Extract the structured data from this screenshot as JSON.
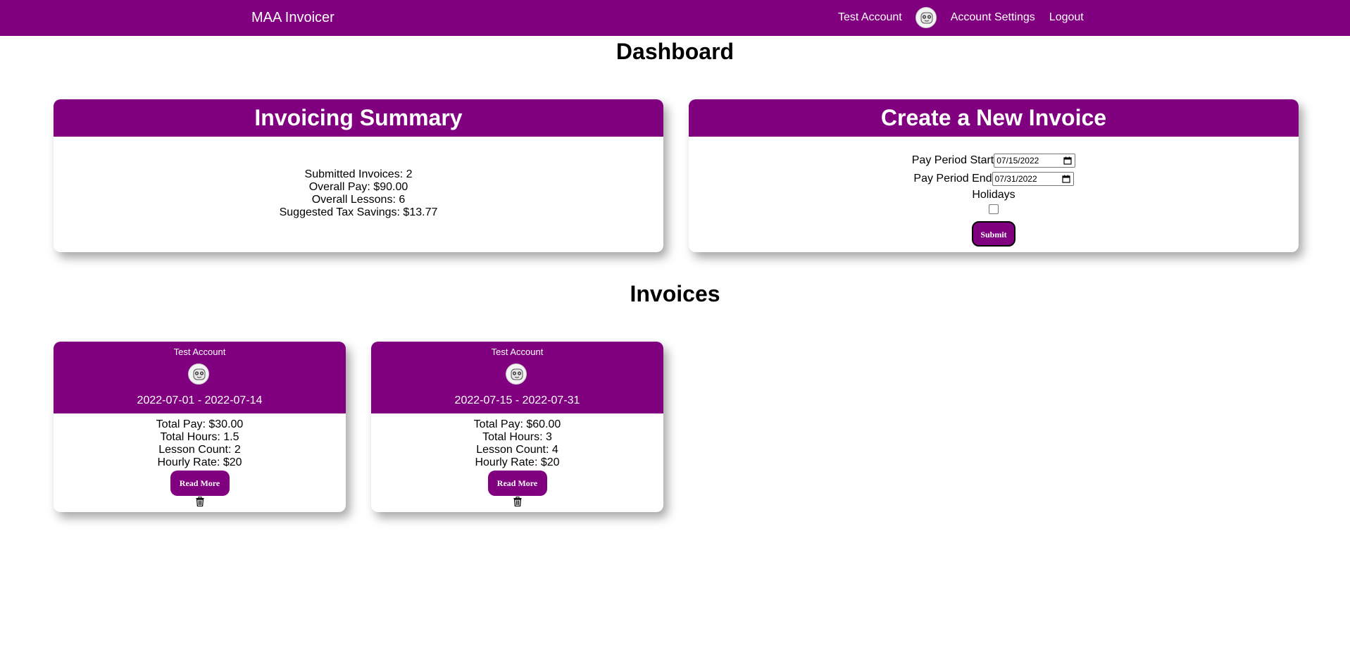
{
  "navbar": {
    "brand": "MAA Invoicer",
    "account_name": "Test Account",
    "account_settings": "Account Settings",
    "logout": "Logout",
    "avatar_icon": "robot-avatar-icon"
  },
  "page_title": "Dashboard",
  "summary": {
    "title": "Invoicing Summary",
    "submitted": "Submitted Invoices: 2",
    "overall_pay": "Overall Pay: $90.00",
    "overall_lessons": "Overall Lessons: 6",
    "tax_savings": "Suggested Tax Savings: $13.77"
  },
  "create": {
    "title": "Create a New Invoice",
    "start_label": "Pay Period Start",
    "start_value": "07/15/2022",
    "end_label": "Pay Period End",
    "end_value": "07/31/2022",
    "holidays_label": "Holidays",
    "holidays_checked": false,
    "submit": "Submit"
  },
  "invoices_title": "Invoices",
  "invoices": [
    {
      "account": "Test Account",
      "period": "2022-07-01 - 2022-07-14",
      "total_pay": "Total Pay: $30.00",
      "total_hours": "Total Hours: 1.5",
      "lesson_count": "Lesson Count: 2",
      "hourly_rate": "Hourly Rate: $20",
      "read_more": "Read More"
    },
    {
      "account": "Test Account",
      "period": "2022-07-15 - 2022-07-31",
      "total_pay": "Total Pay: $60.00",
      "total_hours": "Total Hours: 3",
      "lesson_count": "Lesson Count: 4",
      "hourly_rate": "Hourly Rate: $20",
      "read_more": "Read More"
    }
  ],
  "colors": {
    "brand": "#800080",
    "text_on_brand": "#ffffff"
  }
}
